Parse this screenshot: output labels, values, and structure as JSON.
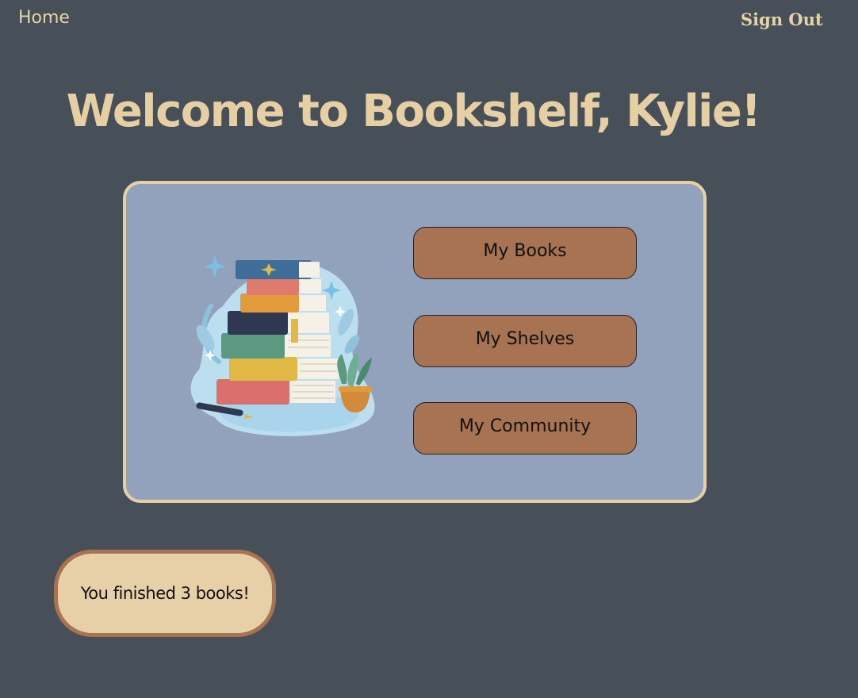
{
  "nav": {
    "home_label": "Home",
    "signout_label": "Sign Out"
  },
  "header": {
    "title": "Welcome to Bookshelf, Kylie!"
  },
  "menu": {
    "items": [
      {
        "label": "My Books"
      },
      {
        "label": "My Shelves"
      },
      {
        "label": "My Community"
      }
    ]
  },
  "stats": {
    "finished_text": "You finished 3 books!"
  },
  "icons": {
    "illustration": "book-stack-icon"
  },
  "colors": {
    "background": "#475058",
    "accent": "#e6cfa3",
    "card": "#92a1bc",
    "button": "#a87352"
  }
}
